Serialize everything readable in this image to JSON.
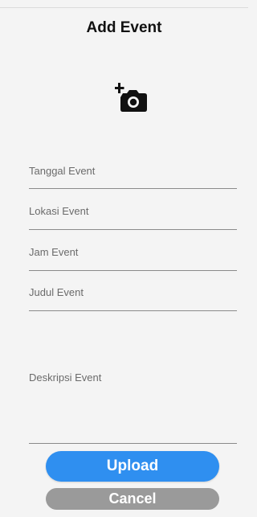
{
  "header": {
    "title": "Add Event"
  },
  "photo": {
    "icon": "add-a-photo-icon"
  },
  "form": {
    "tanggal_placeholder": "Tanggal Event",
    "tanggal_value": "",
    "lokasi_placeholder": "Lokasi Event",
    "lokasi_value": "",
    "jam_placeholder": "Jam Event",
    "jam_value": "",
    "judul_placeholder": "Judul Event",
    "judul_value": "",
    "deskripsi_placeholder": "Deskripsi Event",
    "deskripsi_value": ""
  },
  "actions": {
    "upload_label": "Upload",
    "cancel_label": "Cancel"
  },
  "colors": {
    "primary": "#2f8ff0",
    "secondary": "#9a9a9a",
    "background": "#f4f4f4"
  }
}
